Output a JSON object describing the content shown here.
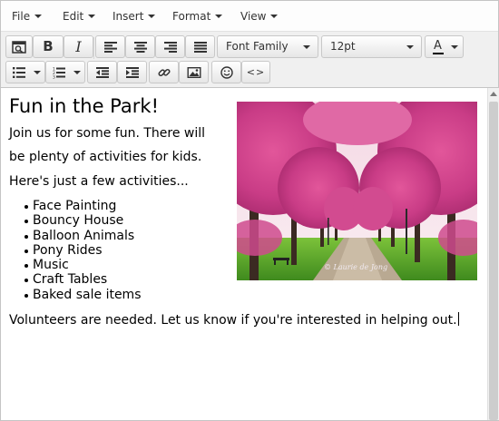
{
  "menubar": {
    "items": [
      {
        "label": "File"
      },
      {
        "label": "Edit"
      },
      {
        "label": "Insert"
      },
      {
        "label": "Format"
      },
      {
        "label": "View"
      }
    ]
  },
  "toolbar": {
    "font_family": "Font Family",
    "font_size": "12pt",
    "text_color_glyph": "A",
    "bold_glyph": "B",
    "italic_glyph": "I",
    "code_glyph": "<>",
    "accent_color": "#e6e6e6",
    "text_color_indicator": "#000000"
  },
  "document": {
    "title": "Fun in the Park!",
    "paragraphs": [
      "Join us for some fun.  There will",
      "be plenty of activities for kids.",
      "Here's just a few activities..."
    ],
    "activities": [
      "Face Painting",
      "Bouncy House",
      "Balloon Animals",
      "Pony Rides",
      "Music",
      "Craft Tables",
      "Baked sale items"
    ],
    "closing": "Volunteers are needed.  Let us know if you're interested in helping out."
  },
  "image": {
    "subject": "tree-lined park path with pink blossoms",
    "watermark": "© Laurie de Jong"
  },
  "icons": {
    "find": "find-icon",
    "bold": "bold-icon",
    "italic": "italic-icon",
    "align_left": "align-left-icon",
    "align_center": "align-center-icon",
    "align_right": "align-right-icon",
    "align_justify": "align-justify-icon",
    "bullet_list": "bullet-list-icon",
    "numbered_list": "numbered-list-icon",
    "outdent": "outdent-icon",
    "indent": "indent-icon",
    "link": "link-icon",
    "image": "image-icon",
    "emoticon": "emoticon-icon",
    "code": "code-icon"
  }
}
